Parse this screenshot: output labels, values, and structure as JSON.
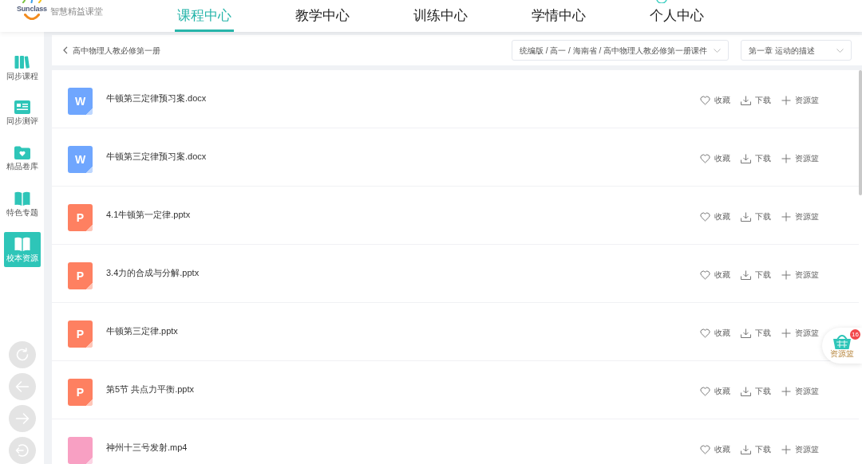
{
  "header": {
    "logo": {
      "brand": "Sunclass",
      "title": "智慧精益课堂"
    },
    "nav": [
      {
        "label": "课程中心",
        "selected": true
      },
      {
        "label": "教学中心",
        "selected": false
      },
      {
        "label": "训练中心",
        "selected": false
      },
      {
        "label": "学情中心",
        "selected": false
      },
      {
        "label": "个人中心",
        "selected": false
      }
    ]
  },
  "sidebar": {
    "items": [
      {
        "label": "同步课程",
        "selected": false
      },
      {
        "label": "同步测评",
        "selected": false
      },
      {
        "label": "精品卷库",
        "selected": false
      },
      {
        "label": "特色专题",
        "selected": false
      },
      {
        "label": "校本资源",
        "selected": true
      }
    ]
  },
  "toolbar": {
    "back_label": "高中物理人教必修第一册",
    "filters": [
      {
        "value": "统编版 / 高一 / 海南省 / 高中物理人教必修第一册课件"
      },
      {
        "value": "第一章 运动的描述"
      }
    ]
  },
  "files": [
    {
      "kind": "word",
      "letter": "W",
      "name": "牛顿第三定律预习案.docx",
      "actions": [
        "收藏",
        "下载",
        "资源篮"
      ]
    },
    {
      "kind": "word",
      "letter": "W",
      "name": "牛顿第三定律预习案.docx",
      "actions": [
        "收藏",
        "下载",
        "资源篮"
      ]
    },
    {
      "kind": "ppt",
      "letter": "P",
      "name": "4.1牛顿第一定律.pptx",
      "actions": [
        "收藏",
        "下载",
        "资源篮"
      ]
    },
    {
      "kind": "ppt",
      "letter": "P",
      "name": "3.4力的合成与分解.pptx",
      "actions": [
        "收藏",
        "下载",
        "资源篮"
      ]
    },
    {
      "kind": "ppt",
      "letter": "P",
      "name": "牛顿第三定律.pptx",
      "actions": [
        "收藏",
        "下载",
        "资源篮"
      ]
    },
    {
      "kind": "ppt",
      "letter": "P",
      "name": "第5节 共点力平衡.pptx",
      "actions": [
        "收藏",
        "下载",
        "资源篮"
      ]
    },
    {
      "kind": "video",
      "name": "神州十三号发射.mp4",
      "actions": [
        "收藏",
        "下载",
        "资源篮"
      ]
    }
  ],
  "basket": {
    "label": "资源篮",
    "count": "16"
  }
}
